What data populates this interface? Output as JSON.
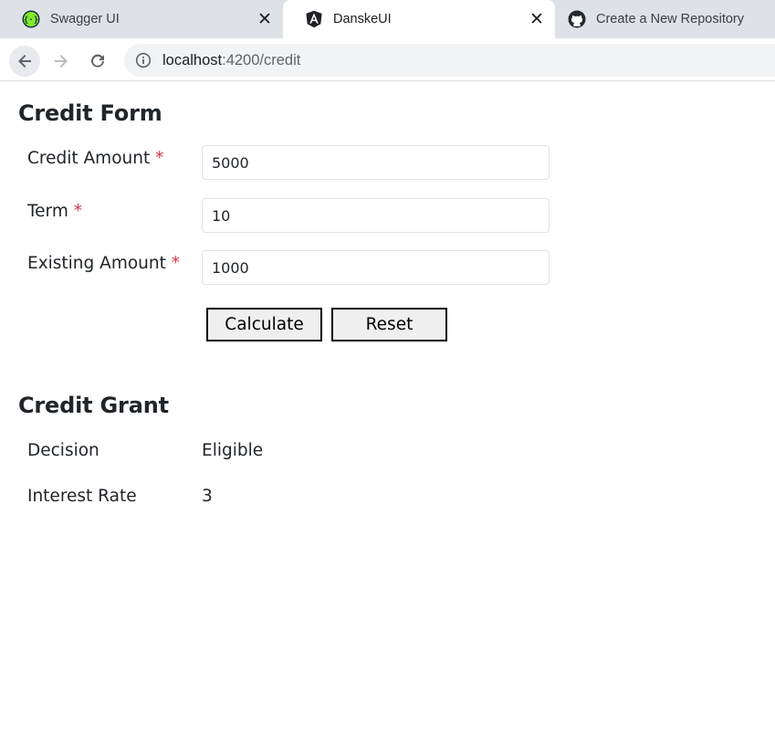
{
  "browser": {
    "tabs": [
      {
        "title": "Swagger UI",
        "icon": "swagger-icon",
        "active": false
      },
      {
        "title": "DanskeUI",
        "icon": "angular-icon",
        "active": true
      },
      {
        "title": "Create a New Repository",
        "icon": "github-icon",
        "active": false
      }
    ],
    "address": {
      "host": "localhost",
      "rest": ":4200/credit"
    }
  },
  "credit_form": {
    "title": "Credit Form",
    "fields": [
      {
        "label": "Credit Amount",
        "required_mark": "*",
        "value": "5000"
      },
      {
        "label": "Term",
        "required_mark": "*",
        "value": "10"
      },
      {
        "label": "Existing Amount",
        "required_mark": "*",
        "value": "1000"
      }
    ],
    "buttons": {
      "calculate": "Calculate",
      "reset": "Reset"
    }
  },
  "credit_grant": {
    "title": "Credit Grant",
    "rows": [
      {
        "label": "Decision",
        "value": "Eligible"
      },
      {
        "label": "Interest Rate",
        "value": "3"
      }
    ]
  },
  "colors": {
    "required": "#dc3545",
    "tabstrip": "#dee1e6",
    "omnibox": "#f1f3f4"
  }
}
